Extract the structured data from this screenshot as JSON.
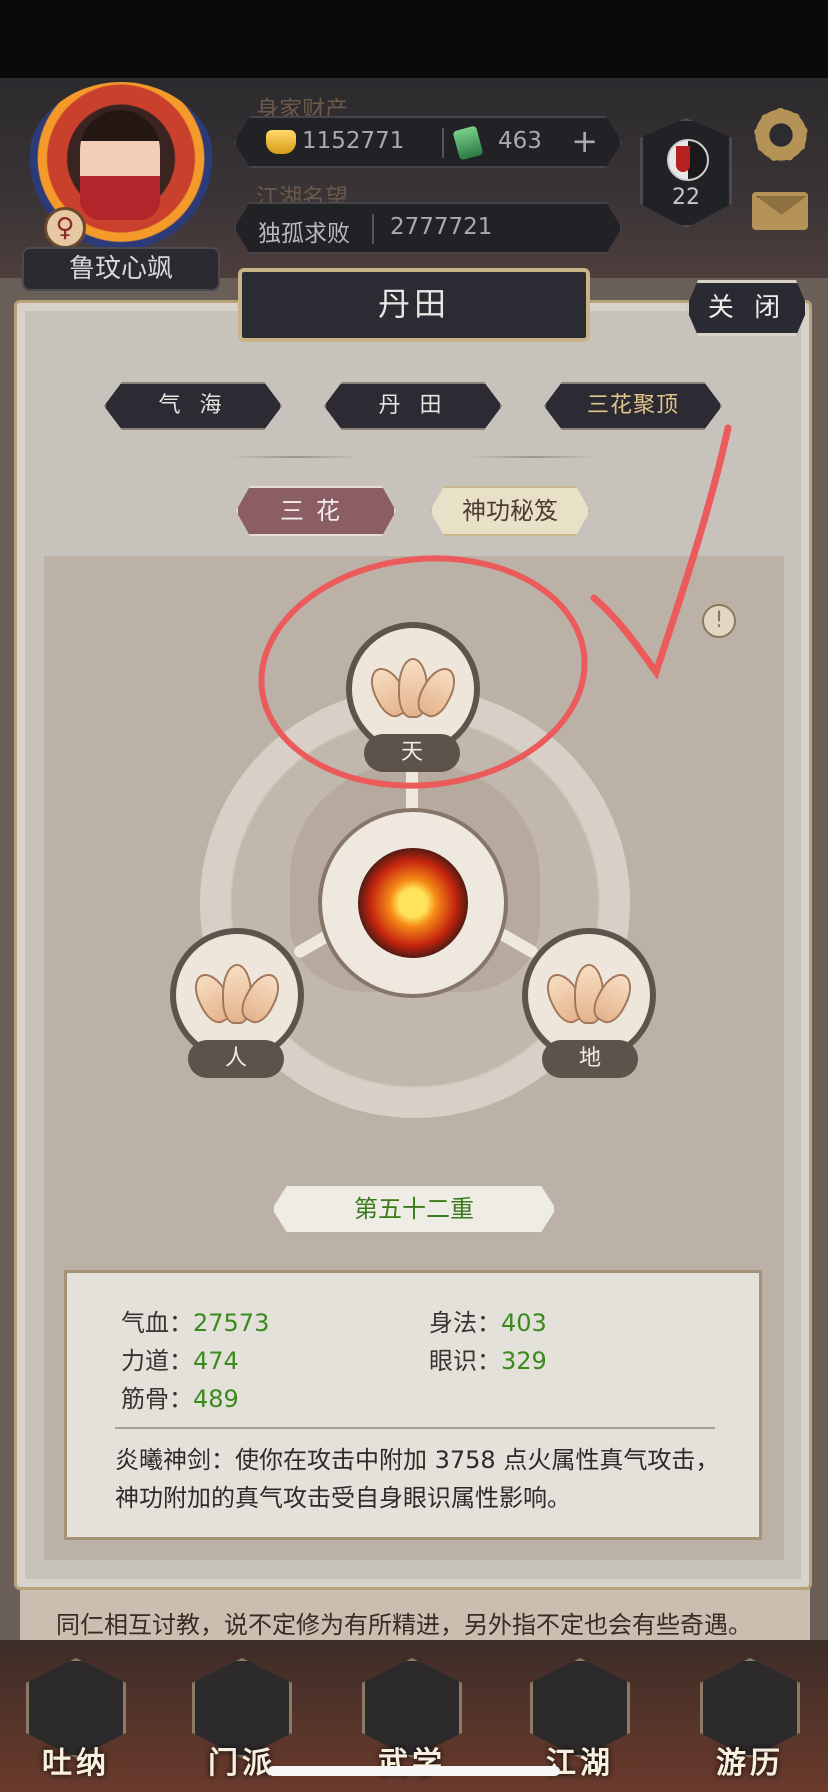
{
  "hud": {
    "assets_label": "身家财产",
    "gold": "1152771",
    "jade": "463",
    "reputation_label": "江湖名望",
    "title": "独孤求败",
    "reputation_value": "2777721",
    "player_name": "鲁玟心飒",
    "gender_symbol": "♀",
    "level": "22"
  },
  "panel": {
    "title": "丹田",
    "close_label": "关 闭"
  },
  "tabs": [
    {
      "label": "气 海",
      "active": false
    },
    {
      "label": "丹 田",
      "active": false
    },
    {
      "label": "三花聚顶",
      "active": true
    }
  ],
  "subtabs": [
    {
      "label": "三花",
      "active": true
    },
    {
      "label": "神功秘笈",
      "active": false
    }
  ],
  "nodes": {
    "top": "天",
    "left": "人",
    "right": "地"
  },
  "info_icon": "!",
  "tier": "第五十二重",
  "stats": {
    "qixue_label": "气血：",
    "qixue_value": "27573",
    "shenfa_label": "身法：",
    "shenfa_value": "403",
    "lidao_label": "力道：",
    "lidao_value": "474",
    "yanshi_label": "眼识：",
    "yanshi_value": "329",
    "jingu_label": "筋骨：",
    "jingu_value": "489"
  },
  "skill_description": "炎曦神剑：使你在攻击中附加 3758 点火属性真气攻击，神功附加的真气攻击受自身眼识属性影响。",
  "background_news": {
    "line2": "同仁相互讨教，说不定修为有所精进，另外指不定也会有些奇遇。"
  },
  "bottom_nav": [
    {
      "label": "吐纳",
      "icon": "meditation-icon"
    },
    {
      "label": "门派",
      "icon": "sect-icon"
    },
    {
      "label": "武学",
      "icon": "martial-book-icon"
    },
    {
      "label": "江湖",
      "icon": "hat-icon"
    },
    {
      "label": "游历",
      "icon": "horse-icon"
    }
  ],
  "colors": {
    "annotation": "#ec5b5b",
    "stat_value": "#3a8a1c",
    "active_subtab": "#8b5e66"
  }
}
